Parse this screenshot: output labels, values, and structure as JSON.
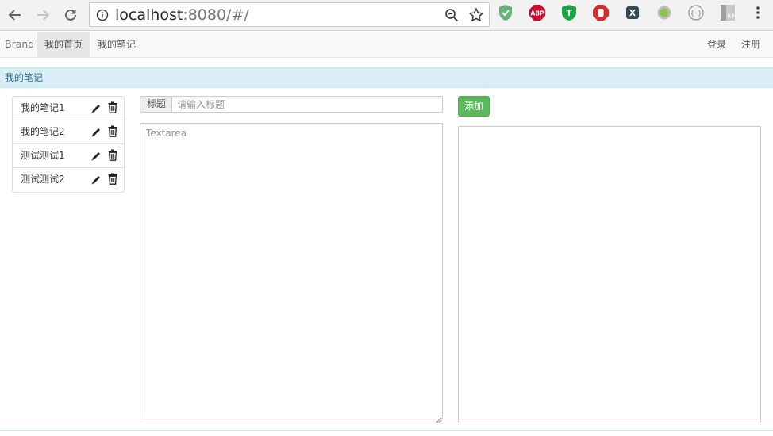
{
  "browser": {
    "url_host": "localhost",
    "url_rest": ":8080/#/",
    "extensions": [
      "adguard-shield-icon",
      "adblock-plus-icon",
      "tampermonkey-icon",
      "hand-stop-icon",
      "x-extension-icon",
      "circle-extension-icon",
      "json-viewer-icon",
      "rp-extension-icon"
    ]
  },
  "navbar": {
    "brand": "Brand",
    "items": [
      {
        "label": "我的首页",
        "active": true
      },
      {
        "label": "我的笔记",
        "active": false
      }
    ],
    "login": "登录",
    "register": "注册"
  },
  "panel": {
    "heading": "我的笔记"
  },
  "notes": [
    {
      "title": "我的笔记1"
    },
    {
      "title": "我的笔记2"
    },
    {
      "title": "测试测试1"
    },
    {
      "title": "测试测试2"
    }
  ],
  "editor": {
    "title_label": "标题",
    "title_placeholder": "请输入标题",
    "title_value": "",
    "content_placeholder": "Textarea",
    "content_value": "",
    "add_label": "添加"
  },
  "colors": {
    "accent_green": "#5cb85c",
    "panel_info": "#d9edf7",
    "panel_text": "#31708f"
  }
}
